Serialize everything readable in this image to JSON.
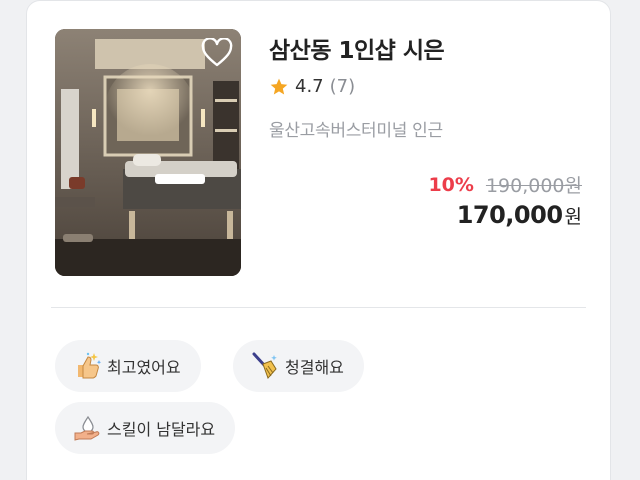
{
  "listing": {
    "title": "삼산동 1인샵 시은",
    "rating": "4.7",
    "review_count": "(7)",
    "location": "울산고속버스터미널 인근",
    "discount": "10%",
    "original_price": "190,000원",
    "final_price": "170,000",
    "currency": "원",
    "favorite_icon": "heart-outline-icon",
    "star_color": "#f5a623",
    "discount_color": "#ec3d4a"
  },
  "tags": [
    {
      "label": "최고였어요",
      "icon": "thumbs-up-sparkle-icon"
    },
    {
      "label": "청결해요",
      "icon": "broom-icon"
    },
    {
      "label": "스킬이 남달라요",
      "icon": "hand-water-drop-icon"
    }
  ]
}
